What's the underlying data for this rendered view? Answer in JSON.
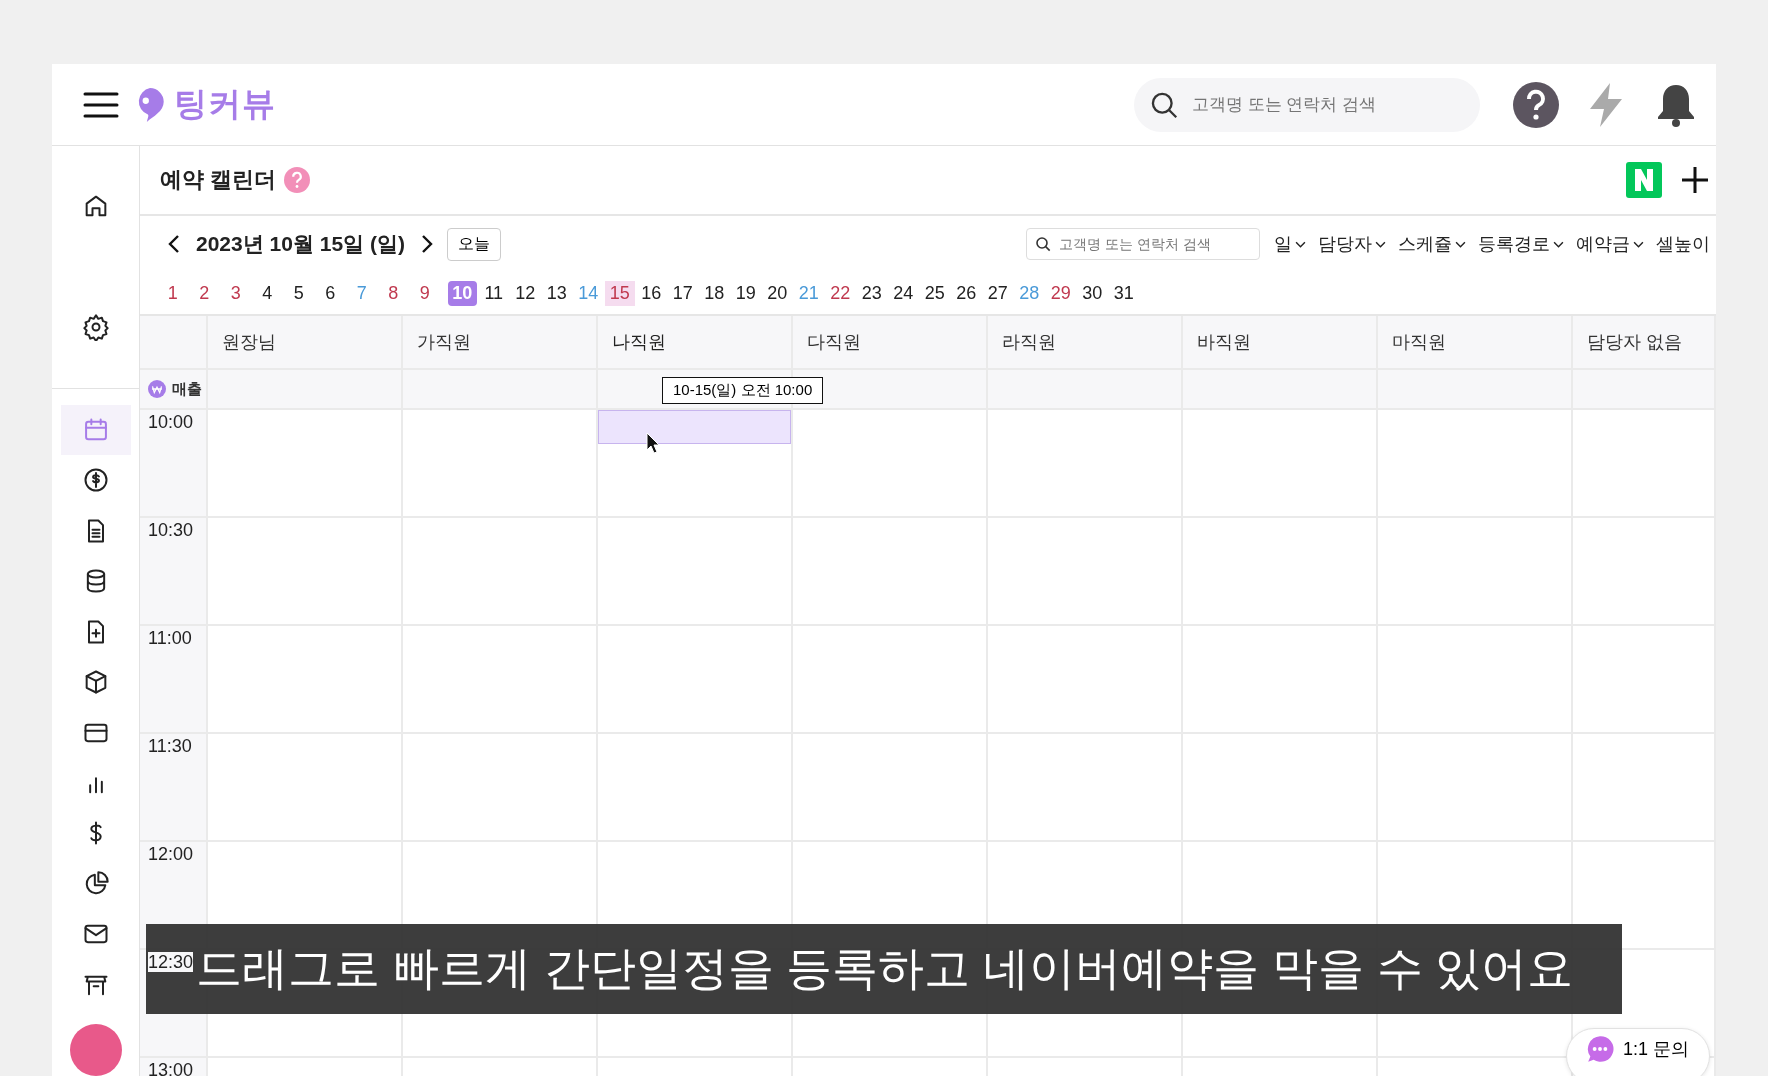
{
  "app": {
    "logo": "팅커뷰",
    "search_placeholder": "고객명 또는 연락처 검색"
  },
  "page": {
    "title": "예약 캘린더"
  },
  "sidebar": {
    "items": [
      {
        "selected": false
      },
      {
        "selected": false
      },
      {
        "selected": true
      },
      {
        "selected": false
      },
      {
        "selected": false
      },
      {
        "selected": false
      },
      {
        "selected": false
      },
      {
        "selected": false
      },
      {
        "selected": false
      },
      {
        "selected": false
      },
      {
        "selected": false
      },
      {
        "selected": false
      },
      {
        "selected": false
      },
      {
        "selected": false
      }
    ]
  },
  "toolbar": {
    "date": "2023년 10월 15일 (일)",
    "today_button": "오늘",
    "search_placeholder": "고객명 또는 연락처 검색",
    "filters": [
      {
        "label": "일",
        "dropdown": true
      },
      {
        "label": "담당자",
        "dropdown": true
      },
      {
        "label": "스케쥴",
        "dropdown": true
      },
      {
        "label": "등록경로",
        "dropdown": true
      },
      {
        "label": "예약금",
        "dropdown": true
      },
      {
        "label": "셀높이",
        "dropdown": false
      }
    ]
  },
  "dates": [
    {
      "label": "1",
      "kind": "holiday",
      "selected": false,
      "today": false
    },
    {
      "label": "2",
      "kind": "holiday",
      "selected": false,
      "today": false
    },
    {
      "label": "3",
      "kind": "holiday",
      "selected": false,
      "today": false
    },
    {
      "label": "4",
      "kind": "weekday",
      "selected": false,
      "today": false
    },
    {
      "label": "5",
      "kind": "weekday",
      "selected": false,
      "today": false
    },
    {
      "label": "6",
      "kind": "weekday",
      "selected": false,
      "today": false
    },
    {
      "label": "7",
      "kind": "saturday",
      "selected": false,
      "today": false
    },
    {
      "label": "8",
      "kind": "holiday",
      "selected": false,
      "today": false
    },
    {
      "label": "9",
      "kind": "holiday",
      "selected": false,
      "today": false
    },
    {
      "label": "10",
      "kind": "weekday",
      "selected": false,
      "today": true
    },
    {
      "label": "11",
      "kind": "weekday",
      "selected": false,
      "today": false
    },
    {
      "label": "12",
      "kind": "weekday",
      "selected": false,
      "today": false
    },
    {
      "label": "13",
      "kind": "weekday",
      "selected": false,
      "today": false
    },
    {
      "label": "14",
      "kind": "saturday",
      "selected": false,
      "today": false
    },
    {
      "label": "15",
      "kind": "holiday",
      "selected": true,
      "today": false
    },
    {
      "label": "16",
      "kind": "weekday",
      "selected": false,
      "today": false
    },
    {
      "label": "17",
      "kind": "weekday",
      "selected": false,
      "today": false
    },
    {
      "label": "18",
      "kind": "weekday",
      "selected": false,
      "today": false
    },
    {
      "label": "19",
      "kind": "weekday",
      "selected": false,
      "today": false
    },
    {
      "label": "20",
      "kind": "weekday",
      "selected": false,
      "today": false
    },
    {
      "label": "21",
      "kind": "saturday",
      "selected": false,
      "today": false
    },
    {
      "label": "22",
      "kind": "holiday",
      "selected": false,
      "today": false
    },
    {
      "label": "23",
      "kind": "weekday",
      "selected": false,
      "today": false
    },
    {
      "label": "24",
      "kind": "weekday",
      "selected": false,
      "today": false
    },
    {
      "label": "25",
      "kind": "weekday",
      "selected": false,
      "today": false
    },
    {
      "label": "26",
      "kind": "weekday",
      "selected": false,
      "today": false
    },
    {
      "label": "27",
      "kind": "weekday",
      "selected": false,
      "today": false
    },
    {
      "label": "28",
      "kind": "saturday",
      "selected": false,
      "today": false
    },
    {
      "label": "29",
      "kind": "holiday",
      "selected": false,
      "today": false
    },
    {
      "label": "30",
      "kind": "weekday",
      "selected": false,
      "today": false
    },
    {
      "label": "31",
      "kind": "weekday",
      "selected": false,
      "today": false
    }
  ],
  "calendar": {
    "columns": [
      {
        "name": "원장님",
        "drag_selection": false
      },
      {
        "name": "가직원",
        "drag_selection": false
      },
      {
        "name": "나직원",
        "drag_selection": true
      },
      {
        "name": "다직원",
        "drag_selection": false
      },
      {
        "name": "라직원",
        "drag_selection": false
      },
      {
        "name": "바직원",
        "drag_selection": false
      },
      {
        "name": "마직원",
        "drag_selection": false
      },
      {
        "name": "담당자 없음",
        "drag_selection": false
      }
    ],
    "sales_label": "매출",
    "times": [
      "10:00",
      "10:30",
      "11:00",
      "11:30",
      "12:00",
      "12:30",
      "13:00"
    ],
    "tooltip": "10-15(일) 오전 10:00"
  },
  "subtitle": "드래그로 빠르게 간단일정을 등록하고 네이버예약을 막을 수 있어요",
  "chat_button": "1:1 문의"
}
